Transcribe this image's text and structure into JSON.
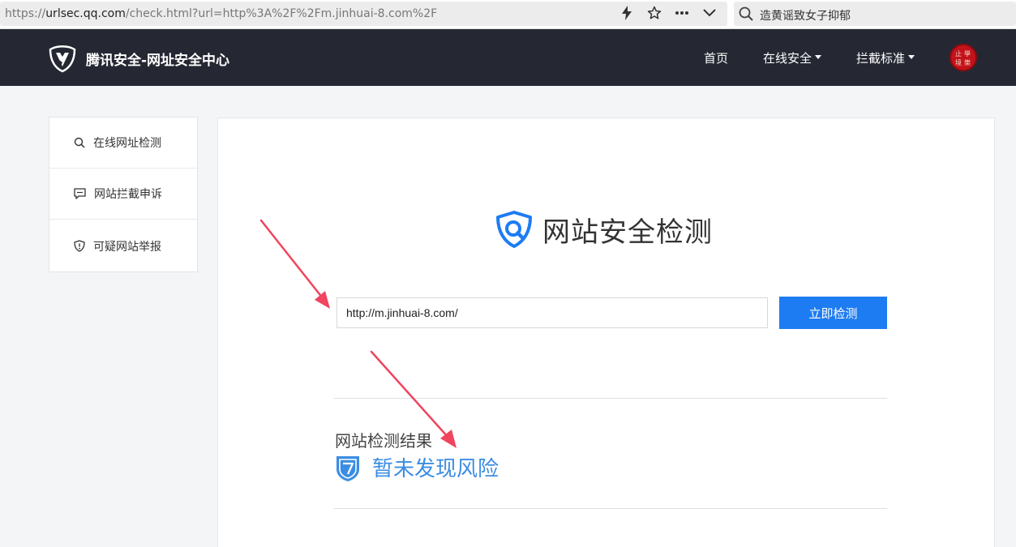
{
  "browser": {
    "url_prefix": "https://",
    "url_host": "urlsec.qq.com",
    "url_path": "/check.html?url=http%3A%2F%2Fm.jinhuai-8.com%2F",
    "search_text": "造黄谣致女子抑郁",
    "icons": [
      "lightning-icon",
      "star-icon",
      "more-icon",
      "chevron-down-icon",
      "search-icon"
    ]
  },
  "header": {
    "brand": "腾讯安全-网址安全中心",
    "nav": [
      {
        "label": "首页",
        "has_dropdown": false
      },
      {
        "label": "在线安全",
        "has_dropdown": true
      },
      {
        "label": "拦截标准",
        "has_dropdown": true
      }
    ],
    "avatar_chars": [
      "止",
      "學",
      "境",
      "樂"
    ]
  },
  "sidebar": {
    "items": [
      {
        "label": "在线网址检测",
        "icon": "search-icon"
      },
      {
        "label": "网站拦截申诉",
        "icon": "message-icon"
      },
      {
        "label": "可疑网站举报",
        "icon": "shield-alert-icon"
      }
    ]
  },
  "main": {
    "title": "网站安全检测",
    "input_value": "http://m.jinhuai-8.com/",
    "check_button": "立即检测",
    "result_label": "网站检测结果",
    "result_value": "暂未发现风险"
  },
  "colors": {
    "header_bg": "#252833",
    "accent": "#1e7cf2",
    "result_blue": "#3b8de3",
    "arrow": "#f0445f"
  }
}
